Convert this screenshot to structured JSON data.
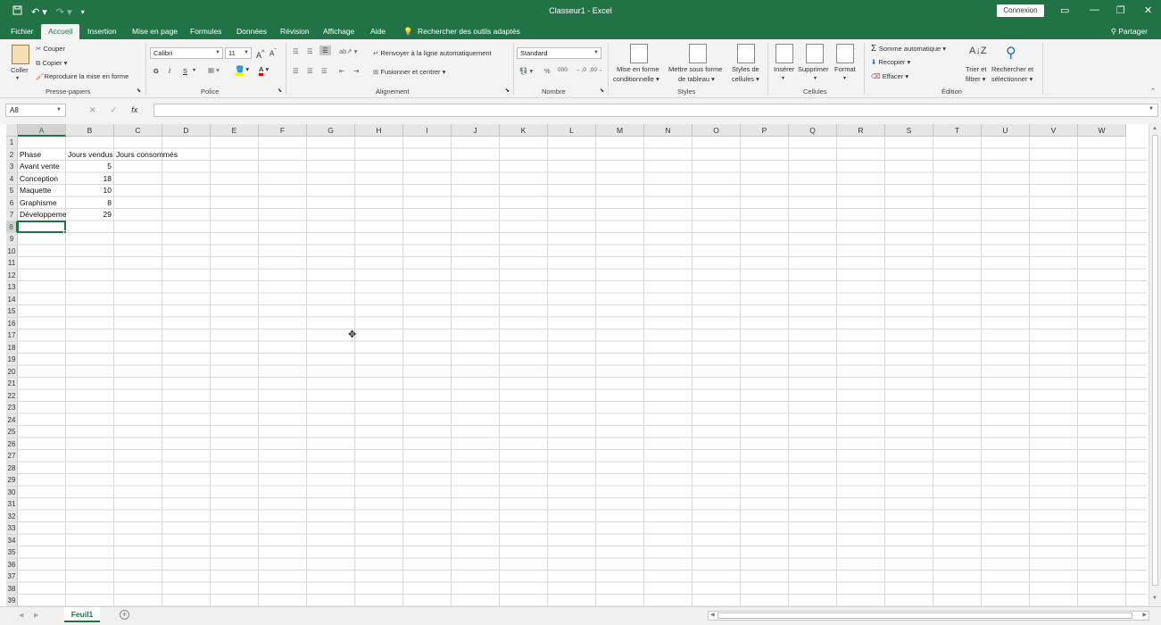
{
  "app": {
    "title": "Classeur1  -  Excel",
    "login_label": "Connexion",
    "share_label": "Partager"
  },
  "tabs": [
    "Fichier",
    "Accueil",
    "Insertion",
    "Mise en page",
    "Formules",
    "Données",
    "Révision",
    "Affichage",
    "Aide"
  ],
  "active_tab": "Accueil",
  "search_hint": "Rechercher des outils adaptés",
  "ribbon": {
    "clipboard": {
      "paste": "Coller",
      "cut": "Couper",
      "copy": "Copier",
      "format_painter": "Reproduire la mise en forme",
      "label": "Presse-papiers"
    },
    "font": {
      "name": "Calibri",
      "size": "11",
      "bold": "G",
      "italic": "I",
      "underline": "S",
      "label": "Police"
    },
    "alignment": {
      "wrap": "Renvoyer à la ligne automatiquement",
      "merge": "Fusionner et centrer",
      "label": "Alignement"
    },
    "number": {
      "format": "Standard",
      "label": "Nombre"
    },
    "styles": {
      "conditional_1": "Mise en forme",
      "conditional_2": "conditionnelle",
      "table_1": "Mettre sous forme",
      "table_2": "de tableau",
      "cell_styles_1": "Styles de",
      "cell_styles_2": "cellules",
      "label": "Styles"
    },
    "cells": {
      "insert": "Insérer",
      "delete": "Supprimer",
      "format": "Format",
      "label": "Cellules"
    },
    "editing": {
      "autosum": "Somme automatique",
      "fill": "Recopier",
      "clear": "Effacer",
      "sort_1": "Trier et",
      "sort_2": "filtrer",
      "find_1": "Rechercher et",
      "find_2": "sélectionner",
      "label": "Édition"
    }
  },
  "formula_bar": {
    "name_box": "A8",
    "fx": "fx",
    "formula": ""
  },
  "columns": [
    "A",
    "B",
    "C",
    "D",
    "E",
    "F",
    "G",
    "H",
    "I",
    "J",
    "K",
    "L",
    "M",
    "N",
    "O",
    "P",
    "Q",
    "R",
    "S",
    "T",
    "U",
    "V",
    "W"
  ],
  "selected_column": "A",
  "selected_row": 8,
  "row_count": 39,
  "cells": {
    "A2": "Phase",
    "B2": "Jours vendus",
    "C2": "Jours consommés",
    "A3": "Avant vente",
    "B3": "5",
    "A4": "Conception",
    "B4": "18",
    "A5": "Maquette",
    "B5": "10",
    "A6": "Graphisme",
    "B6": "8",
    "A7": "Développement",
    "B7": "29"
  },
  "sheets": [
    "Feuil1"
  ],
  "colors": {
    "accent": "#217346",
    "ribbon_bg": "#f3f3f3",
    "header_bg": "#e6e6e6"
  }
}
